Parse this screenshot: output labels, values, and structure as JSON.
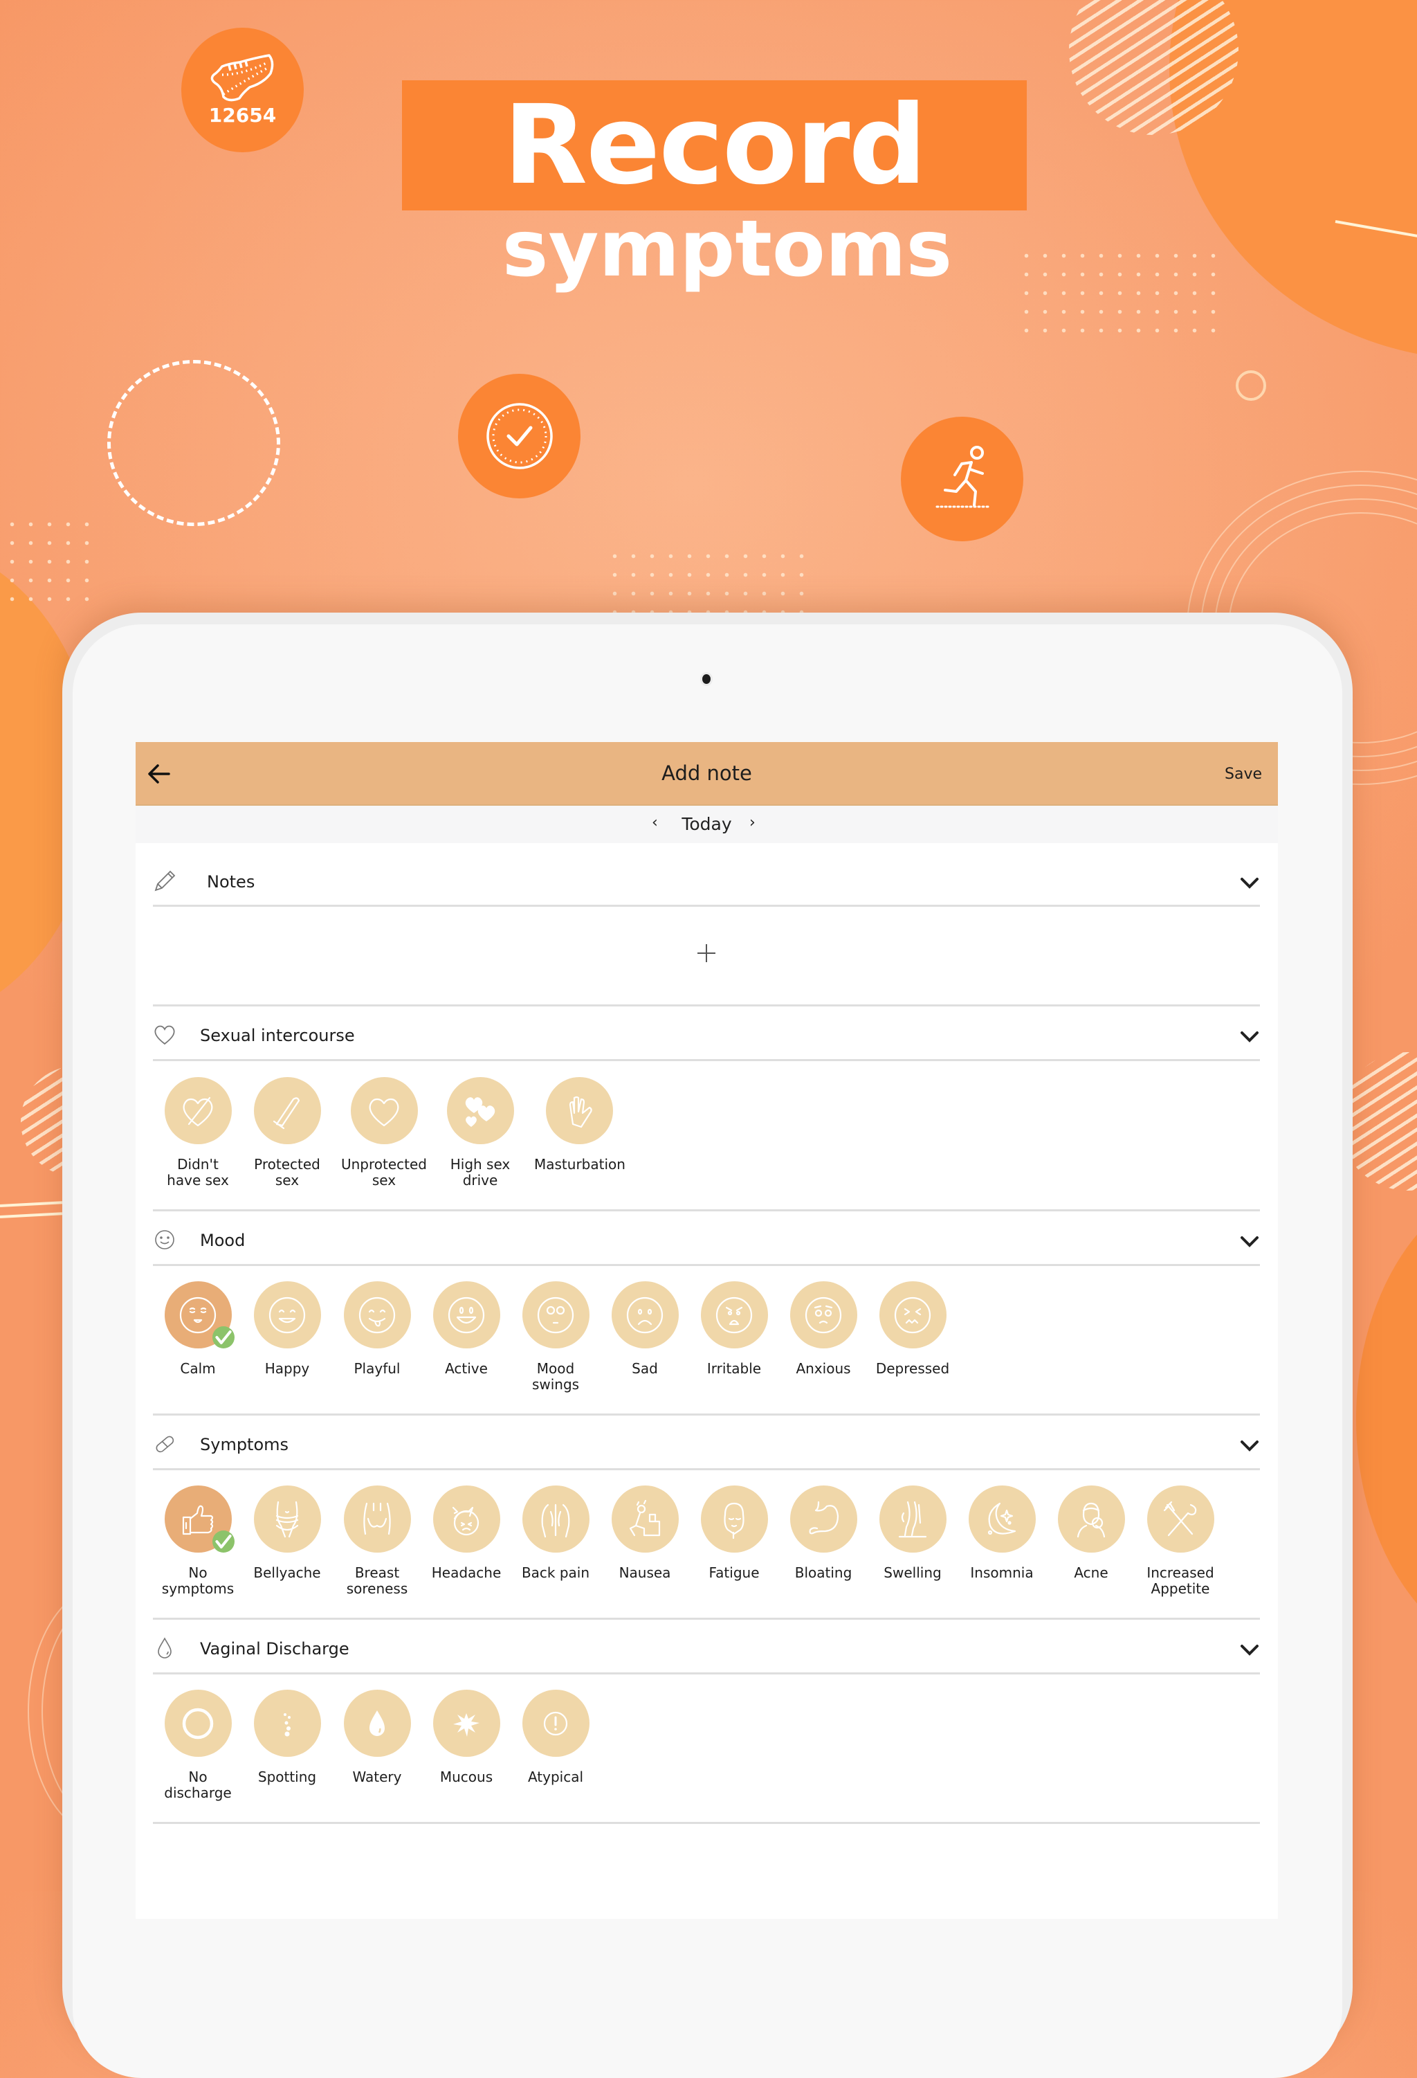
{
  "hero": {
    "title_line1": "Record",
    "title_line2": "symptoms",
    "steps_count": "12654",
    "badges": [
      "sneaker-icon",
      "check-seal-icon",
      "running-person-icon"
    ]
  },
  "colors": {
    "background": "#f9a77a",
    "accent_orange": "#fb8534",
    "appbar": "#e9b582",
    "option_default": "#f0d7a9",
    "option_selected": "#e8ad77",
    "check_badge": "#8cc36a"
  },
  "appbar": {
    "title": "Add note",
    "save_label": "Save",
    "back_icon": "arrow-left-icon"
  },
  "daynav": {
    "label": "Today",
    "prev": "‹",
    "next": "›"
  },
  "sections": {
    "notes": {
      "title": "Notes",
      "icon": "pencil-icon",
      "add_label": "+"
    },
    "sex": {
      "title": "Sexual intercourse",
      "icon": "heart-outline-icon",
      "options": [
        {
          "label": "Didn't\nhave sex",
          "icon": "heart-crossed-icon",
          "selected": false
        },
        {
          "label": "Protected\nsex",
          "icon": "condom-icon",
          "selected": false
        },
        {
          "label": "Unprotected\nsex",
          "icon": "heart-icon",
          "selected": false
        },
        {
          "label": "High sex\ndrive",
          "icon": "hearts-icon",
          "selected": false
        },
        {
          "label": "Masturbation",
          "icon": "hand-icon",
          "selected": false
        }
      ]
    },
    "mood": {
      "title": "Mood",
      "icon": "smiley-outline-icon",
      "options": [
        {
          "label": "Calm",
          "icon": "calm-face-icon",
          "selected": true
        },
        {
          "label": "Happy",
          "icon": "happy-face-icon",
          "selected": false
        },
        {
          "label": "Playful",
          "icon": "playful-face-icon",
          "selected": false
        },
        {
          "label": "Active",
          "icon": "active-face-icon",
          "selected": false
        },
        {
          "label": "Mood\nswings",
          "icon": "eyeroll-face-icon",
          "selected": false
        },
        {
          "label": "Sad",
          "icon": "sad-face-icon",
          "selected": false
        },
        {
          "label": "Irritable",
          "icon": "angry-face-icon",
          "selected": false
        },
        {
          "label": "Anxious",
          "icon": "anxious-face-icon",
          "selected": false
        },
        {
          "label": "Depressed",
          "icon": "depressed-face-icon",
          "selected": false
        }
      ]
    },
    "symptoms": {
      "title": "Symptoms",
      "icon": "pill-icon",
      "options": [
        {
          "label": "No\nsymptoms",
          "icon": "thumbs-up-icon",
          "selected": true
        },
        {
          "label": "Bellyache",
          "icon": "belly-icon",
          "selected": false
        },
        {
          "label": "Breast\nsoreness",
          "icon": "breast-icon",
          "selected": false
        },
        {
          "label": "Headache",
          "icon": "headache-icon",
          "selected": false
        },
        {
          "label": "Back pain",
          "icon": "back-icon",
          "selected": false
        },
        {
          "label": "Nausea",
          "icon": "nausea-icon",
          "selected": false
        },
        {
          "label": "Fatigue",
          "icon": "fatigue-icon",
          "selected": false
        },
        {
          "label": "Bloating",
          "icon": "stomach-icon",
          "selected": false
        },
        {
          "label": "Swelling",
          "icon": "legs-icon",
          "selected": false
        },
        {
          "label": "Insomnia",
          "icon": "moon-icon",
          "selected": false
        },
        {
          "label": "Acne",
          "icon": "acne-face-icon",
          "selected": false
        },
        {
          "label": "Increased\nAppetite",
          "icon": "fork-spoon-icon",
          "selected": false
        }
      ]
    },
    "discharge": {
      "title": "Vaginal Discharge",
      "icon": "drop-outline-icon",
      "options": [
        {
          "label": "No\ndischarge",
          "icon": "ring-icon",
          "selected": false
        },
        {
          "label": "Spotting",
          "icon": "spotting-icon",
          "selected": false
        },
        {
          "label": "Watery",
          "icon": "drop-icon",
          "selected": false
        },
        {
          "label": "Mucous",
          "icon": "splash-icon",
          "selected": false
        },
        {
          "label": "Atypical",
          "icon": "exclamation-circle-icon",
          "selected": false
        }
      ]
    }
  }
}
